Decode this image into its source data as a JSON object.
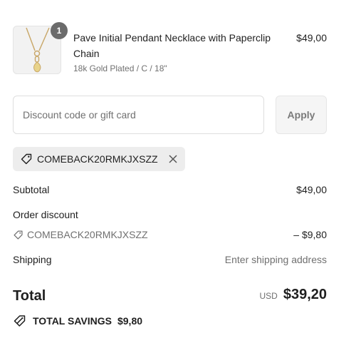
{
  "product": {
    "quantity": "1",
    "title": "Pave Initial Pendant Necklace with Paperclip Chain",
    "variant": "18k Gold Plated / C / 18\"",
    "price": "$49,00"
  },
  "discount": {
    "placeholder": "Discount code or gift card",
    "apply_label": "Apply",
    "applied_code": "COMEBACK20RMKJXSZZ"
  },
  "summary": {
    "subtotal_label": "Subtotal",
    "subtotal_value": "$49,00",
    "order_discount_label": "Order discount",
    "discount_code": "COMEBACK20RMKJXSZZ",
    "discount_value": "– $9,80",
    "shipping_label": "Shipping",
    "shipping_value": "Enter shipping address",
    "total_label": "Total",
    "currency": "USD",
    "total_value": "$39,20",
    "savings_label": "TOTAL SAVINGS",
    "savings_value": "$9,80"
  },
  "colors": {
    "text": "#1f1f1f",
    "muted": "#707070",
    "badge": "#6b6b6b",
    "chip_bg": "#ededed"
  }
}
